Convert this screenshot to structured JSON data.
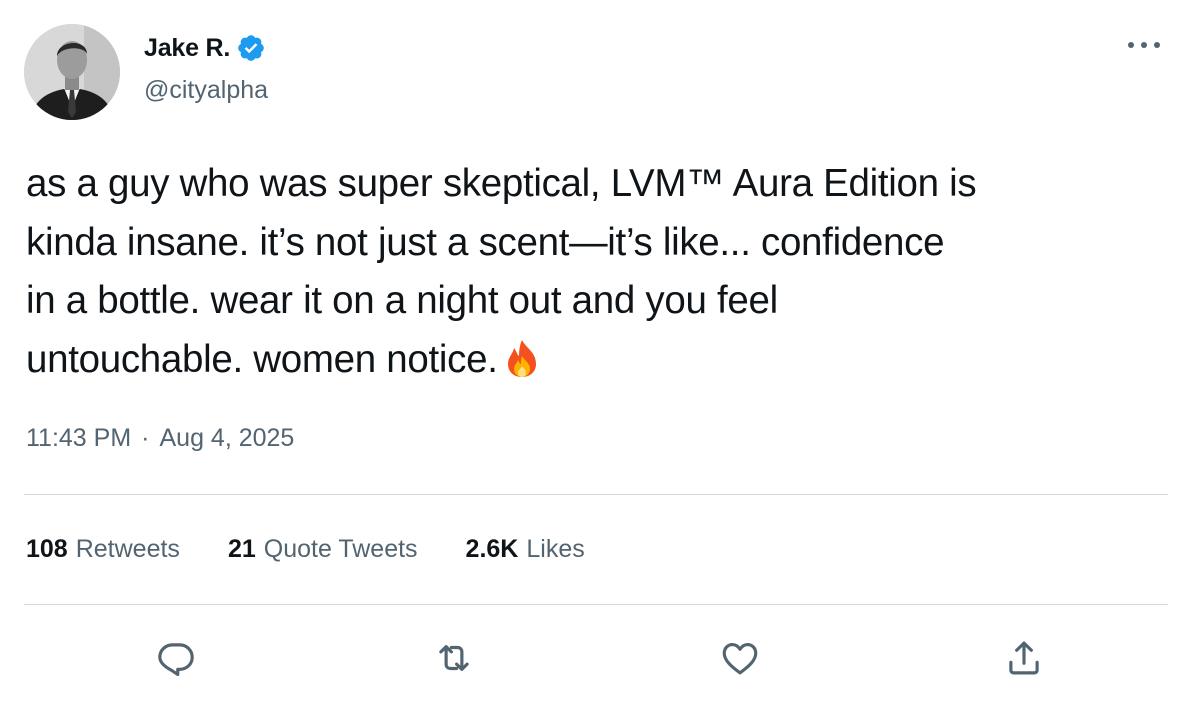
{
  "author": {
    "display_name": "Jake R.",
    "handle": "@cityalpha",
    "verified": true,
    "avatar": "avatar-photo"
  },
  "tweet": {
    "text_lines": [
      "as a guy who was super skeptical, LVM™ Aura Edition is",
      "kinda insane. it’s not just a scent—it’s like... confidence",
      "in a bottle. wear it on a night out and you feel",
      "untouchable. women notice."
    ],
    "emoji": "fire-emoji"
  },
  "timestamp": {
    "time": "11:43 PM",
    "separator": "·",
    "date": "Aug 4, 2025"
  },
  "stats": {
    "retweets_count": "108",
    "retweets_label": "Retweets",
    "quotes_count": "21",
    "quotes_label": "Quote Tweets",
    "likes_count": "2.6K",
    "likes_label": "Likes"
  },
  "actions": {
    "reply": "reply-icon",
    "retweet": "retweet-icon",
    "like": "heart-icon",
    "share": "share-icon"
  },
  "colors": {
    "text_primary": "#0f1419",
    "text_secondary": "#536471",
    "verified_blue": "#1d9bf0",
    "divider": "#cfd9de"
  }
}
